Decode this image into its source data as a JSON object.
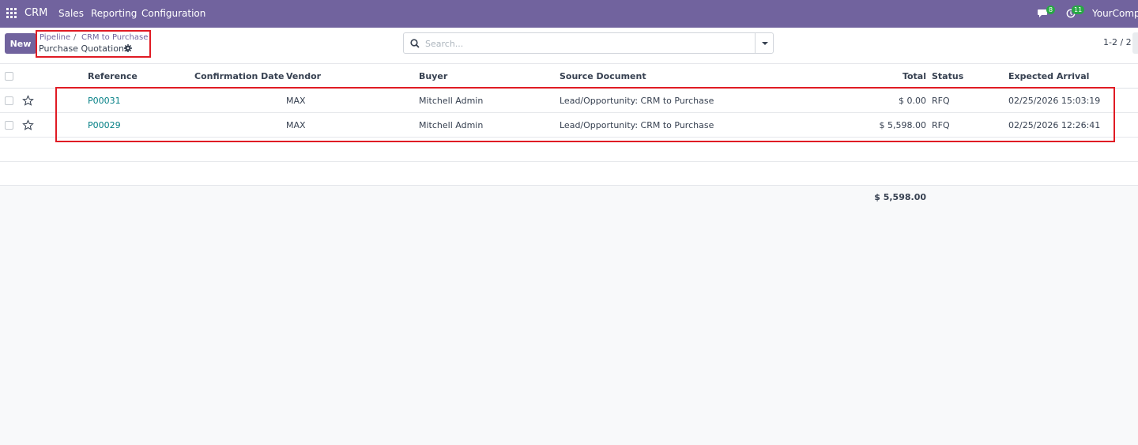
{
  "navbar": {
    "brand": "CRM",
    "menu": [
      "Sales",
      "Reporting",
      "Configuration"
    ],
    "messages_count": "8",
    "activities_count": "11",
    "company": "YourCompa",
    "color": "#71639e"
  },
  "control": {
    "new_label": "New",
    "breadcrumb": [
      "Pipeline",
      "CRM to Purchase"
    ],
    "breadcrumb_sep": "/",
    "current": "Purchase Quotations",
    "search_placeholder": "Search...",
    "pager": "1-2 / 2"
  },
  "table": {
    "columns": [
      "Reference",
      "Confirmation Date",
      "Vendor",
      "Buyer",
      "Source Document",
      "Total",
      "Status",
      "Expected Arrival"
    ],
    "rows": [
      {
        "reference": "P00031",
        "confirmation_date": "",
        "vendor": "MAX",
        "buyer": "Mitchell Admin",
        "source": "Lead/Opportunity: CRM to Purchase",
        "total": "$ 0.00",
        "status": "RFQ",
        "expected": "02/25/2026 15:03:19"
      },
      {
        "reference": "P00029",
        "confirmation_date": "",
        "vendor": "MAX",
        "buyer": "Mitchell Admin",
        "source": "Lead/Opportunity: CRM to Purchase",
        "total": "$ 5,598.00",
        "status": "RFQ",
        "expected": "02/25/2026 12:26:41"
      }
    ],
    "sum_total": "$ 5,598.00"
  },
  "colors": {
    "highlight": "#e01b24",
    "link": "#017e84",
    "badge": "#28a745"
  }
}
